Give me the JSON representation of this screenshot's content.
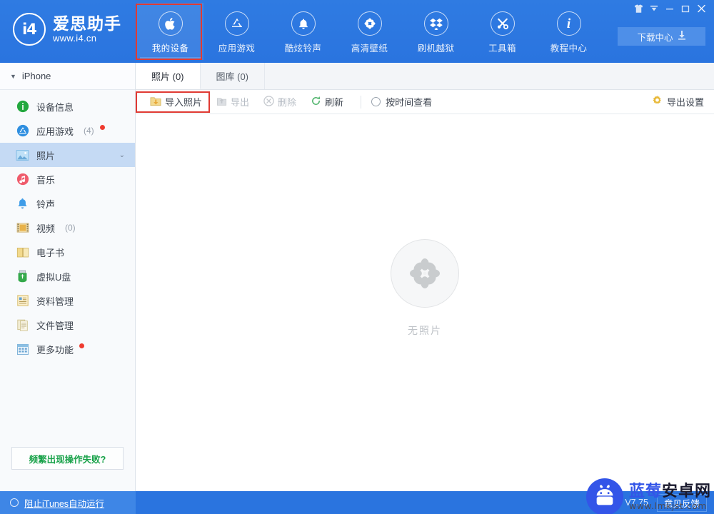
{
  "app": {
    "brand_name": "爱思助手",
    "brand_url": "www.i4.cn",
    "logo_mark": "i4",
    "accent_blue": "#2a74df",
    "highlight_red": "#e03a33"
  },
  "window_controls": [
    {
      "name": "skin",
      "glyph": "👕"
    },
    {
      "name": "menu",
      "glyph": "▼"
    },
    {
      "name": "minimize",
      "glyph": "—"
    },
    {
      "name": "maximize",
      "glyph": "▢"
    },
    {
      "name": "close",
      "glyph": "✕"
    }
  ],
  "download_center": {
    "label": "下载中心",
    "icon": "download-icon"
  },
  "nav": {
    "items": [
      {
        "label": "我的设备",
        "icon": "apple-icon",
        "active": true
      },
      {
        "label": "应用游戏",
        "icon": "appstore-icon",
        "active": false
      },
      {
        "label": "酷炫铃声",
        "icon": "bell-icon",
        "active": false
      },
      {
        "label": "高清壁纸",
        "icon": "flower-icon",
        "active": false
      },
      {
        "label": "刷机越狱",
        "icon": "dropbox-icon",
        "active": false
      },
      {
        "label": "工具箱",
        "icon": "tools-icon",
        "active": false
      },
      {
        "label": "教程中心",
        "icon": "info-icon",
        "active": false
      }
    ]
  },
  "sidebar": {
    "device": {
      "name": "iPhone",
      "caret": "▼"
    },
    "items": [
      {
        "label": "设备信息",
        "count": "",
        "icon": "info-circle-icon",
        "color": "#23a83f",
        "active": false,
        "badge": false,
        "chevron": false
      },
      {
        "label": "应用游戏",
        "count": "(4)",
        "icon": "appstore-circle-icon",
        "color": "#2f8fe0",
        "active": false,
        "badge": true,
        "chevron": false
      },
      {
        "label": "照片",
        "count": "",
        "icon": "photo-icon",
        "color": "#5aa9e6",
        "active": true,
        "badge": false,
        "chevron": true
      },
      {
        "label": "音乐",
        "count": "",
        "icon": "music-icon",
        "color": "#ef5b6b",
        "active": false,
        "badge": false,
        "chevron": false
      },
      {
        "label": "铃声",
        "count": "",
        "icon": "ringtone-bell-icon",
        "color": "#3e9ce8",
        "active": false,
        "badge": false,
        "chevron": false
      },
      {
        "label": "视频",
        "count": "(0)",
        "icon": "video-icon",
        "color": "#e8b24a",
        "active": false,
        "badge": false,
        "chevron": false
      },
      {
        "label": "电子书",
        "count": "",
        "icon": "book-icon",
        "color": "#e8c35a",
        "active": false,
        "badge": false,
        "chevron": false
      },
      {
        "label": "虚拟U盘",
        "count": "",
        "icon": "usb-icon",
        "color": "#34a94a",
        "active": false,
        "badge": false,
        "chevron": false
      },
      {
        "label": "资料管理",
        "count": "",
        "icon": "data-manage-icon",
        "color": "#e8c35a",
        "active": false,
        "badge": false,
        "chevron": false
      },
      {
        "label": "文件管理",
        "count": "",
        "icon": "file-manage-icon",
        "color": "#d8cf9a",
        "active": false,
        "badge": false,
        "chevron": false
      },
      {
        "label": "更多功能",
        "count": "",
        "icon": "more-grid-icon",
        "color": "#6fb2e0",
        "active": false,
        "badge": true,
        "chevron": false
      }
    ],
    "help_button": "频繁出现操作失败?"
  },
  "main": {
    "tabs": [
      {
        "label": "照片 (0)",
        "active": true
      },
      {
        "label": "图库 (0)",
        "active": false
      }
    ],
    "toolbar": {
      "import": {
        "label": "导入照片",
        "icon": "import-photo-icon",
        "enabled": true,
        "highlighted": true
      },
      "export": {
        "label": "导出",
        "icon": "export-icon",
        "enabled": false
      },
      "delete": {
        "label": "删除",
        "icon": "delete-icon",
        "enabled": false
      },
      "refresh": {
        "label": "刷新",
        "icon": "refresh-icon",
        "enabled": true
      },
      "view_by_time": {
        "label": "按时间查看",
        "icon": "radio-circle-icon",
        "checked": false
      },
      "export_settings": {
        "label": "导出设置",
        "icon": "gear-icon"
      }
    },
    "empty_state": {
      "text": "无照片",
      "icon": "flower-placeholder-icon"
    }
  },
  "statusbar": {
    "itunes_toggle": {
      "label": "阻止iTunes自动运行",
      "checked": false
    },
    "version": "V7.75",
    "feedback": "意见反馈"
  },
  "watermark": {
    "cn_blue": "蓝莓",
    "cn_dark": "安卓网",
    "url": "www.lmkjst.com",
    "icon": "android-robot-icon"
  }
}
